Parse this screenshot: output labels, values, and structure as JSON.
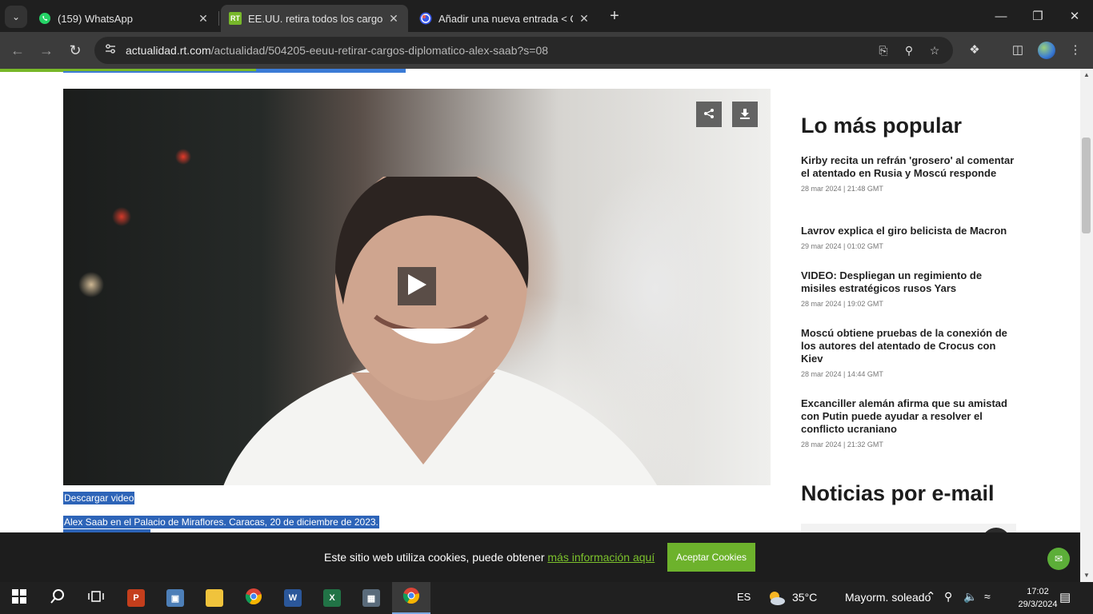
{
  "browser": {
    "tabs": [
      {
        "title": "(159) WhatsApp",
        "icon": "whatsapp-icon",
        "active": false
      },
      {
        "title": "EE.UU. retira todos los cargos co",
        "icon": "rt-icon",
        "active": true
      },
      {
        "title": "Añadir una nueva entrada < CR",
        "icon": "wordpress-icon",
        "active": false
      }
    ],
    "favicon_rt_text": "RT",
    "url_domain": "actualidad.rt.com",
    "url_path": "/actualidad/504205-eeuu-retirar-cargos-diplomatico-alex-saab?s=08"
  },
  "article": {
    "download_label": "Descargar video",
    "caption": "Alex Saab en el Palacio de Miraflores. Caracas, 20 de diciembre de 2023."
  },
  "sidebar": {
    "popular_heading": "Lo más popular",
    "items": [
      {
        "title": "Kirby recita un refrán 'grosero' al comentar el atentado en Rusia y Moscú responde",
        "date": "28 mar 2024 | 21:48 GMT"
      },
      {
        "title": "Lavrov explica el giro belicista de Macron",
        "date": "29 mar 2024 | 01:02 GMT"
      },
      {
        "title": "VIDEO: Despliegan un regimiento de misiles estratégicos rusos Yars",
        "date": "28 mar 2024 | 19:02 GMT"
      },
      {
        "title": "Moscú obtiene pruebas de la conexión de los autores del atentado de Crocus con Kiev",
        "date": "28 mar 2024 | 14:44 GMT"
      },
      {
        "title": "Excanciller alemán afirma que su amistad con Putin puede ayudar a resolver el conflicto ucraniano",
        "date": "28 mar 2024 | 21:32 GMT"
      }
    ],
    "email_heading": "Noticias por e-mail"
  },
  "cookies": {
    "text": "Este sitio web utiliza cookies, puede obtener ",
    "link": "más información aquí",
    "accept": "Aceptar Cookies"
  },
  "taskbar": {
    "language": "ES",
    "weather_temp": "35°C",
    "weather_desc": "Mayorm. soleado",
    "time": "17:02",
    "date": "29/3/2024",
    "ppt_letter": "P",
    "word_letter": "W",
    "excel_letter": "X"
  },
  "colors": {
    "rt_green": "#78b829",
    "selection_blue": "#2d64b8",
    "cookie_button": "#6db22c"
  }
}
